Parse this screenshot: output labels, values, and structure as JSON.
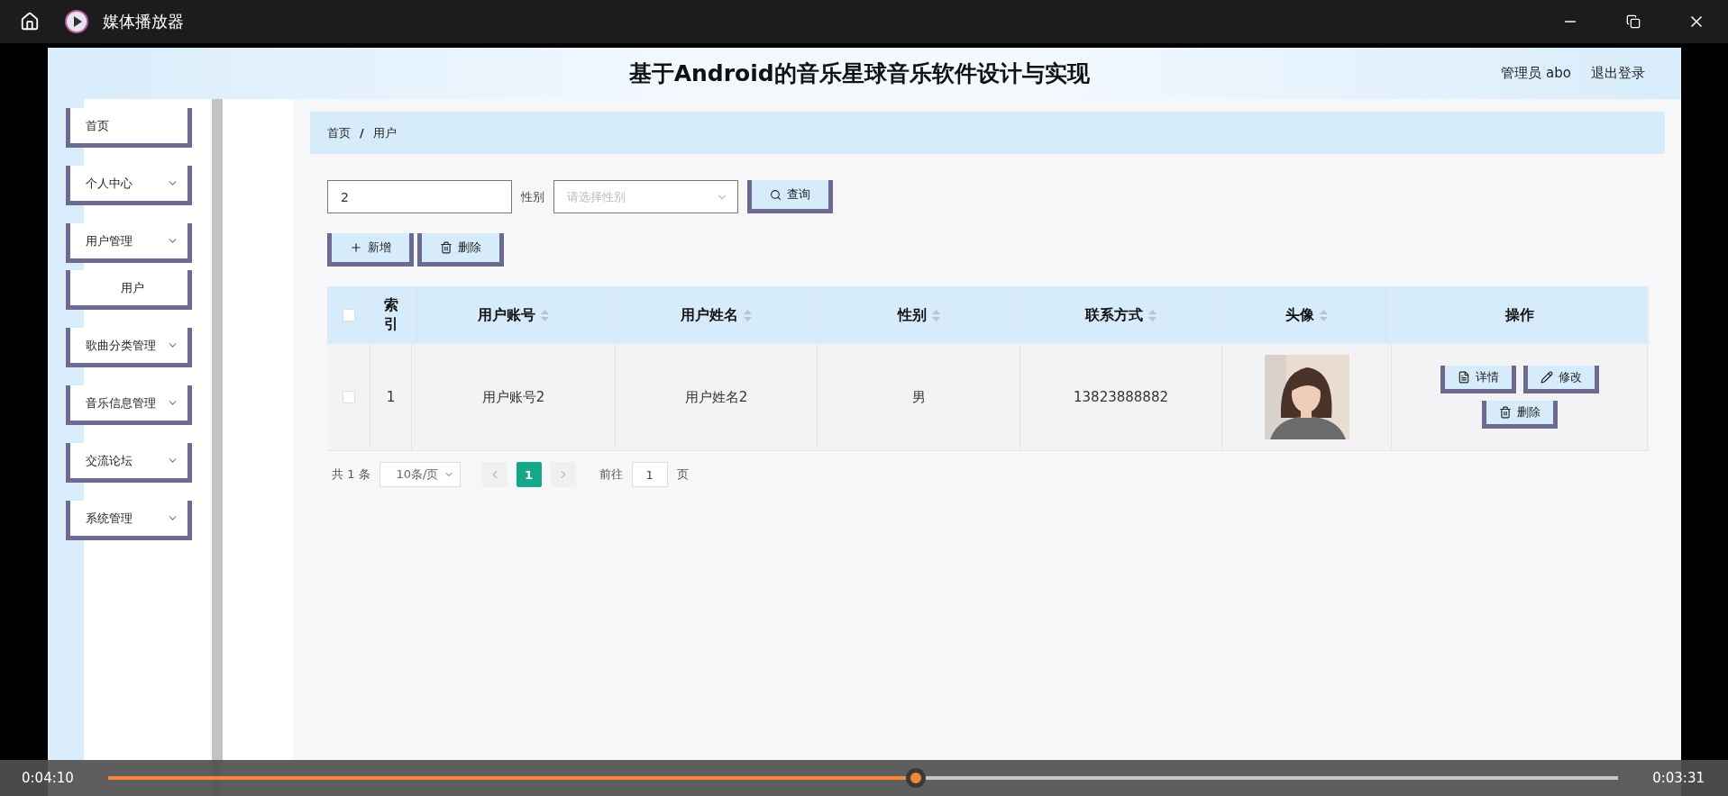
{
  "window": {
    "title": "媒体播放器"
  },
  "page": {
    "title": "基于Android的音乐星球音乐软件设计与实现",
    "user": "管理员 abo",
    "logout": "退出登录"
  },
  "sidebar": {
    "items": [
      {
        "label": "首页",
        "kind": "link"
      },
      {
        "label": "个人中心",
        "kind": "menu"
      },
      {
        "label": "用户管理",
        "kind": "menu",
        "children": [
          {
            "label": "用户"
          }
        ]
      },
      {
        "label": "歌曲分类管理",
        "kind": "menu"
      },
      {
        "label": "音乐信息管理",
        "kind": "menu"
      },
      {
        "label": "交流论坛",
        "kind": "menu"
      },
      {
        "label": "系统管理",
        "kind": "menu"
      }
    ]
  },
  "breadcrumb": {
    "items": [
      "首页",
      "用户"
    ],
    "separator": "/"
  },
  "search": {
    "value": "2",
    "gender_label": "性别",
    "gender_placeholder": "请选择性别",
    "button": "查询"
  },
  "actions": [
    {
      "kind": "add",
      "label": "新增"
    },
    {
      "kind": "delete",
      "label": "删除"
    }
  ],
  "table": {
    "header_checked": false,
    "columns": [
      {
        "label": "索引",
        "sortable": false
      },
      {
        "label": "用户账号",
        "sortable": true
      },
      {
        "label": "用户姓名",
        "sortable": true
      },
      {
        "label": "性别",
        "sortable": true
      },
      {
        "label": "联系方式",
        "sortable": true
      },
      {
        "label": "头像",
        "sortable": true
      },
      {
        "label": "操作",
        "sortable": false
      }
    ],
    "rows": [
      {
        "checked": false,
        "cells": [
          {
            "kind": "text",
            "text": "1"
          },
          {
            "kind": "text",
            "text": "用户账号2"
          },
          {
            "kind": "text",
            "text": "用户姓名2"
          },
          {
            "kind": "text",
            "text": "男"
          },
          {
            "kind": "text",
            "text": "13823888882"
          },
          {
            "kind": "picture"
          },
          {
            "kind": "actions",
            "buttons": [
              {
                "kind": "detail",
                "label": "详情"
              },
              {
                "kind": "edit",
                "label": "修改"
              },
              {
                "kind": "delete",
                "label": "删除"
              }
            ]
          }
        ]
      }
    ]
  },
  "pagination": {
    "total": "共 1 条",
    "page_size": "10条/页",
    "pages": [
      {
        "label": "1",
        "selected": true
      }
    ],
    "goto_label": "前往",
    "goto_value": "1",
    "page_unit": "页"
  },
  "player": {
    "elapsed": "0:04:10",
    "remaining": "0:03:31",
    "level": 0.535
  }
}
